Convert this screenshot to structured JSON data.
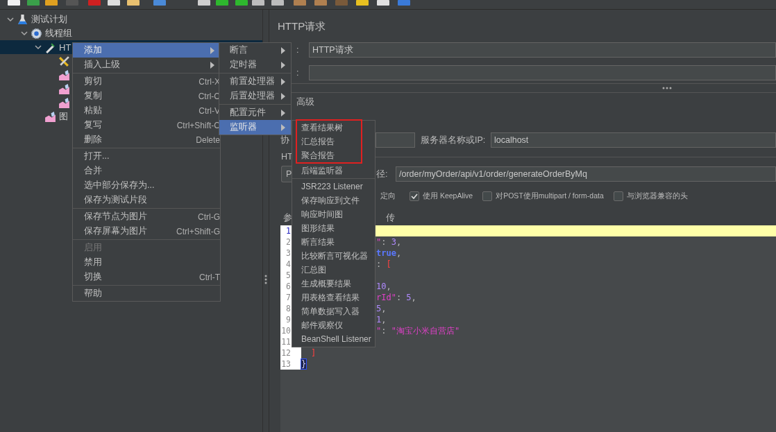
{
  "tree": [
    {
      "kind": "plan",
      "label": "测试计划",
      "expanded": true,
      "selected": false,
      "children": [
        {
          "kind": "thread_group",
          "label": "线程组",
          "expanded": true,
          "selected": false,
          "children": [
            {
              "kind": "sampler",
              "label": "HT",
              "expanded": true,
              "selected": true,
              "children": [
                {
                  "kind": "config",
                  "selected": false
                },
                {
                  "kind": "listener",
                  "selected": false
                },
                {
                  "kind": "listener",
                  "selected": false
                },
                {
                  "kind": "listener",
                  "selected": false
                }
              ]
            },
            {
              "kind": "listener",
              "label": "图",
              "selected": false
            }
          ]
        }
      ]
    }
  ],
  "context_menu": {
    "groups": [
      [
        {
          "label": "添加",
          "submenu": true,
          "selected": true,
          "disabled": false
        },
        {
          "label": "插入上级",
          "submenu": true,
          "selected": false,
          "disabled": false
        }
      ],
      [
        {
          "label": "剪切",
          "shortcut": "Ctrl-X",
          "selected": false,
          "disabled": false
        },
        {
          "label": "复制",
          "shortcut": "Ctrl-C",
          "selected": false,
          "disabled": false
        },
        {
          "label": "粘贴",
          "shortcut": "Ctrl-V",
          "selected": false,
          "disabled": false
        },
        {
          "label": "复写",
          "shortcut": "Ctrl+Shift-C",
          "selected": false,
          "disabled": false
        },
        {
          "label": "删除",
          "shortcut": "Delete",
          "selected": false,
          "disabled": false
        }
      ],
      [
        {
          "label": "打开...",
          "selected": false,
          "disabled": false
        },
        {
          "label": "合并",
          "selected": false,
          "disabled": false
        },
        {
          "label": "选中部分保存为...",
          "selected": false,
          "disabled": false
        },
        {
          "label": "保存为测试片段",
          "selected": false,
          "disabled": false
        }
      ],
      [
        {
          "label": "保存节点为图片",
          "shortcut": "Ctrl-G",
          "selected": false,
          "disabled": false
        },
        {
          "label": "保存屏幕为图片",
          "shortcut": "Ctrl+Shift-G",
          "selected": false,
          "disabled": false
        }
      ],
      [
        {
          "label": "启用",
          "selected": false,
          "disabled": true
        },
        {
          "label": "禁用",
          "selected": false,
          "disabled": false
        },
        {
          "label": "切换",
          "shortcut": "Ctrl-T",
          "selected": false,
          "disabled": false
        }
      ],
      [
        {
          "label": "帮助",
          "selected": false,
          "disabled": false
        }
      ]
    ]
  },
  "add_submenu": {
    "groups": [
      [
        {
          "label": "断言",
          "submenu": true,
          "selected": false
        },
        {
          "label": "定时器",
          "submenu": true,
          "selected": false
        }
      ],
      [
        {
          "label": "前置处理器",
          "submenu": true,
          "selected": false
        },
        {
          "label": "后置处理器",
          "submenu": true,
          "selected": false
        }
      ],
      [
        {
          "label": "配置元件",
          "submenu": true,
          "selected": false
        },
        {
          "label": "监听器",
          "submenu": true,
          "selected": true
        }
      ]
    ]
  },
  "listener_submenu": {
    "groups": [
      [
        {
          "label": "查看结果树",
          "marked": true
        },
        {
          "label": "汇总报告",
          "marked": true
        },
        {
          "label": "聚合报告",
          "marked": true
        },
        {
          "label": "后端监听器",
          "marked": false
        }
      ],
      [
        {
          "label": "JSR223 Listener",
          "marked": false
        },
        {
          "label": "保存响应到文件",
          "marked": false
        },
        {
          "label": "响应时间图",
          "marked": false
        },
        {
          "label": "图形结果",
          "marked": false
        },
        {
          "label": "断言结果",
          "marked": false
        },
        {
          "label": "比较断言可视化器",
          "marked": false
        },
        {
          "label": "汇总图",
          "marked": false
        },
        {
          "label": "生成概要结果",
          "marked": false
        },
        {
          "label": "用表格查看结果",
          "marked": false
        },
        {
          "label": "简单数据写入器",
          "marked": false
        },
        {
          "label": "邮件观察仪",
          "marked": false
        },
        {
          "label": "BeanShell Listener",
          "marked": false
        }
      ]
    ]
  },
  "form": {
    "title": "HTTP请求",
    "name_row": {
      "label": ":",
      "value": "HTTP请求"
    },
    "comment_row": {
      "label": ":"
    },
    "tab": "高级",
    "protocol_label": "协",
    "server_label": "服务器名称或IP:",
    "server_value": "localhost",
    "group_label": "HT",
    "method": "P",
    "path_label": "径:",
    "path_value": "/order/myOrder/api/v1/order/generateOrderByMq",
    "options": [
      {
        "kind": "text",
        "label": "定向"
      },
      {
        "kind": "checkbox",
        "label": "使用 KeepAlive",
        "checked": true
      },
      {
        "kind": "checkbox",
        "label": "对POST使用multipart / form-data",
        "checked": false
      },
      {
        "kind": "checkbox",
        "label": "与浏览器兼容的头",
        "checked": false
      }
    ],
    "body_tabs": [
      "参",
      "传"
    ]
  },
  "editor": {
    "lines": [
      {
        "number": "1",
        "current": true
      },
      {
        "number": "2",
        "current": false,
        "clipped": true,
        "indented": false,
        "tokens": [
          {
            "kind": "string",
            "text": "\""
          },
          {
            "kind": "punct",
            "text": ": "
          },
          {
            "kind": "number",
            "text": "3"
          },
          {
            "kind": "punct",
            "text": ","
          }
        ]
      },
      {
        "number": "3",
        "current": false,
        "clipped": true,
        "indented": false,
        "tokens": [
          {
            "kind": "keyword",
            "text": "true"
          },
          {
            "kind": "punct",
            "text": ","
          }
        ]
      },
      {
        "number": "4",
        "current": false,
        "clipped": true,
        "indented": false,
        "tokens": [
          {
            "kind": "punct",
            "text": ": "
          },
          {
            "kind": "bracket",
            "text": "["
          }
        ]
      },
      {
        "number": "5",
        "current": false
      },
      {
        "number": "6",
        "current": false,
        "clipped": true,
        "indented": false,
        "tokens": [
          {
            "kind": "number",
            "text": "10"
          },
          {
            "kind": "punct",
            "text": ","
          }
        ]
      },
      {
        "number": "7",
        "current": false,
        "clipped": true,
        "indented": false,
        "tokens": [
          {
            "kind": "string",
            "text": "rId\""
          },
          {
            "kind": "punct",
            "text": ": "
          },
          {
            "kind": "number",
            "text": "5"
          },
          {
            "kind": "punct",
            "text": ","
          }
        ]
      },
      {
        "number": "8",
        "current": false,
        "clipped": true,
        "indented": false,
        "tokens": [
          {
            "kind": "number",
            "text": "5"
          },
          {
            "kind": "punct",
            "text": ","
          }
        ]
      },
      {
        "number": "9",
        "current": false,
        "clipped": true,
        "indented": false,
        "tokens": [
          {
            "kind": "number",
            "text": "1"
          },
          {
            "kind": "punct",
            "text": ","
          }
        ]
      },
      {
        "number": "10",
        "current": false,
        "clipped": true,
        "indented": false,
        "tokens": [
          {
            "kind": "string",
            "text": "\""
          },
          {
            "kind": "punct",
            "text": ": "
          },
          {
            "kind": "string",
            "text": "\"淘宝小米自营店\""
          }
        ]
      },
      {
        "number": "11",
        "current": false
      },
      {
        "number": "12",
        "current": false,
        "clipped": false,
        "indented": true,
        "tokens": [
          {
            "kind": "bracket",
            "text": "]"
          }
        ]
      },
      {
        "number": "13",
        "current": false,
        "clipped": false,
        "indented": false,
        "tokens": [
          {
            "kind": "match",
            "text": "}"
          }
        ]
      }
    ]
  }
}
